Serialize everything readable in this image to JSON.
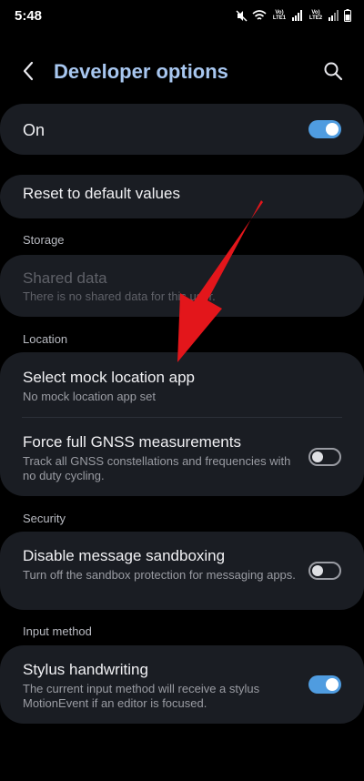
{
  "status_bar": {
    "time": "5:48",
    "sim1": "Vo) LTE1",
    "sim2": "Vo) LTE2"
  },
  "header": {
    "title": "Developer options",
    "back_icon": "back-arrow-icon",
    "search_icon": "search-icon"
  },
  "master": {
    "label": "On",
    "toggle_on": true
  },
  "reset": {
    "label": "Reset to default values"
  },
  "storage": {
    "section": "Storage",
    "shared_data": {
      "title": "Shared data",
      "subtitle": "There is no shared data for this user."
    }
  },
  "location": {
    "section": "Location",
    "mock": {
      "title": "Select mock location app",
      "subtitle": "No mock location app set"
    },
    "gnss": {
      "title": "Force full GNSS measurements",
      "subtitle": "Track all GNSS constellations and frequencies with no duty cycling.",
      "toggle_on": false
    }
  },
  "security": {
    "section": "Security",
    "sandbox": {
      "title": "Disable message sandboxing",
      "subtitle": "Turn off the sandbox protection for messaging apps.",
      "toggle_on": false
    }
  },
  "input_method": {
    "section": "Input method",
    "stylus": {
      "title": "Stylus handwriting",
      "subtitle": "The current input method will receive a stylus MotionEvent if an editor is focused.",
      "toggle_on": true
    }
  },
  "colors": {
    "accent": "#4f9ce0",
    "title": "#a8c7f0",
    "card": "#1a1d23",
    "arrow": "#e3161b"
  }
}
